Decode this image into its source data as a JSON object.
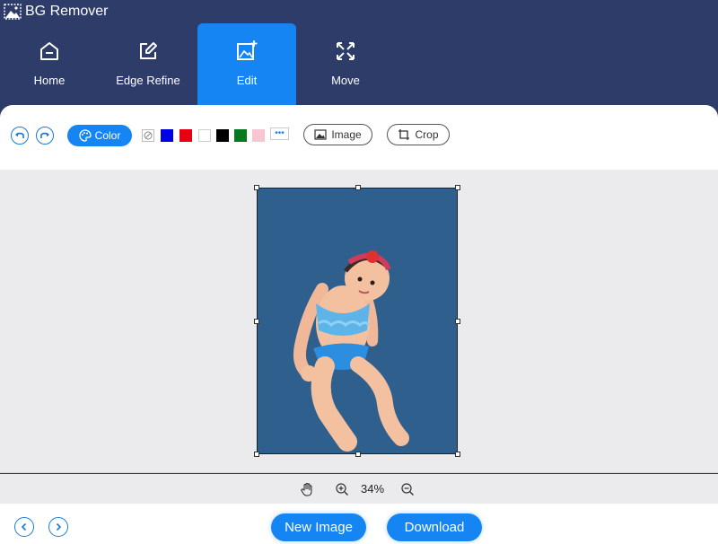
{
  "app": {
    "title": "BG Remover",
    "icon": "landscape-logo-icon"
  },
  "tabs": [
    {
      "label": "Home",
      "icon": "home-icon",
      "active": false
    },
    {
      "label": "Edge Refine",
      "icon": "pencil-square-icon",
      "active": false
    },
    {
      "label": "Edit",
      "icon": "image-plus-icon",
      "active": true
    },
    {
      "label": "Move",
      "icon": "arrows-out-icon",
      "active": false
    }
  ],
  "toolbar": {
    "undo_icon": "undo-icon",
    "redo_icon": "redo-icon",
    "color_label": "Color",
    "swatches": [
      "none",
      "#0000e6",
      "#e60012",
      "#ffffff",
      "#000000",
      "#047a1e",
      "#f7c6d2"
    ],
    "more_icon": "ellipsis-icon",
    "image_label": "Image",
    "crop_label": "Crop"
  },
  "canvas": {
    "background_color": "#2f5f8d",
    "subject": "toddler in blue ruffled swimsuit"
  },
  "zoom": {
    "value": "34%"
  },
  "footer": {
    "new_image_label": "New Image",
    "download_label": "Download"
  },
  "colors": {
    "accent": "#1585f4",
    "header": "#2e3c6a"
  }
}
